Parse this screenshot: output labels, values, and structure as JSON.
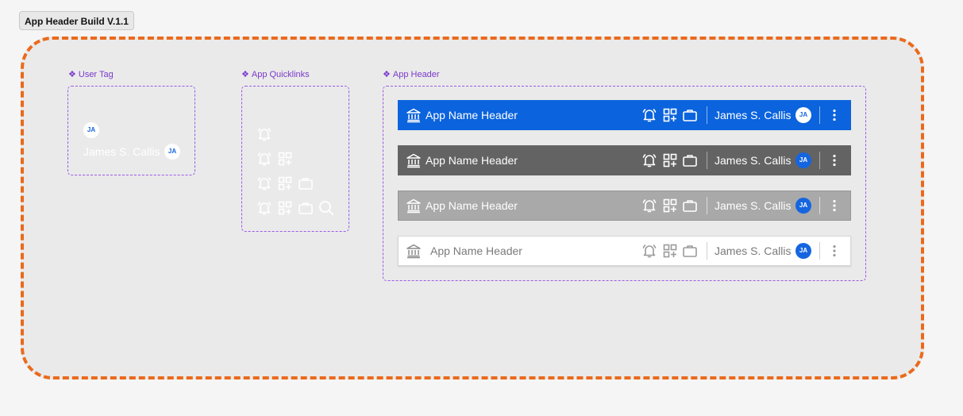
{
  "frame_title": "App Header Build V.1.1",
  "colors": {
    "board_border": "#ea6a1c",
    "component_outline": "#9b59e8",
    "primary_blue": "#0b63dd",
    "dark_gray": "#636363",
    "mid_gray": "#a9a9a9",
    "white": "#ffffff"
  },
  "components": {
    "user_tag": {
      "label": "User Tag",
      "avatar_initials": "JA",
      "user_name": "James S. Callis"
    },
    "app_quicklinks": {
      "label": "App Quicklinks",
      "rows": [
        [
          "bell-icon"
        ],
        [
          "bell-icon",
          "grid-add-icon"
        ],
        [
          "bell-icon",
          "grid-add-icon",
          "briefcase-icon"
        ],
        [
          "bell-icon",
          "grid-add-icon",
          "briefcase-icon",
          "search-icon"
        ]
      ]
    },
    "app_header": {
      "label": "App Header",
      "variants": [
        {
          "style": "blue",
          "title": "App Name Header",
          "user_name": "James S. Callis",
          "avatar_initials": "JA"
        },
        {
          "style": "dark",
          "title": "App Name Header",
          "user_name": "James S. Callis",
          "avatar_initials": "JA"
        },
        {
          "style": "gray",
          "title": "App Name Header",
          "user_name": "James S. Callis",
          "avatar_initials": "JA"
        },
        {
          "style": "white",
          "title": "App Name Header",
          "user_name": "James S. Callis",
          "avatar_initials": "JA"
        }
      ]
    }
  }
}
